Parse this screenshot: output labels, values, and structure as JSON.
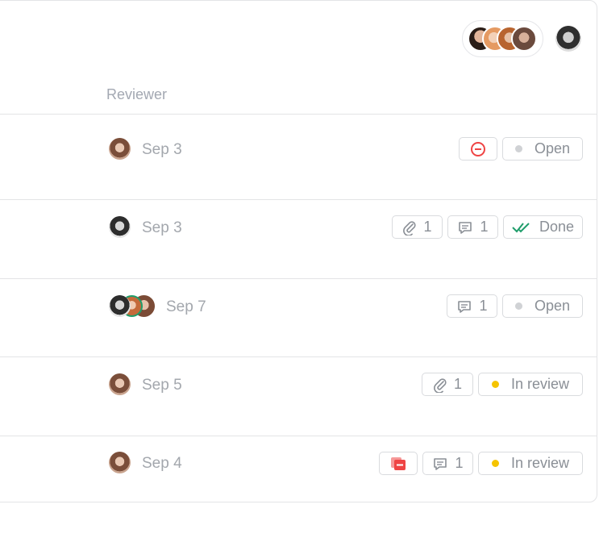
{
  "header": {
    "members_group_avatars": [
      "member-avatar-1",
      "member-avatar-2",
      "member-avatar-3",
      "member-avatar-4"
    ],
    "current_user_avatar": "user-avatar"
  },
  "columns": {
    "reviewer": "Reviewer"
  },
  "rows": [
    {
      "date": "Sep 3",
      "status": "Open"
    },
    {
      "date": "Sep 3",
      "attachments": "1",
      "comments": "1",
      "status": "Done"
    },
    {
      "date": "Sep 7",
      "comments": "1",
      "status": "Open"
    },
    {
      "date": "Sep 5",
      "attachments": "1",
      "status": "In review"
    },
    {
      "date": "Sep 4",
      "comments": "1",
      "status": "In review"
    }
  ],
  "colors": {
    "open": "#d0d2d5",
    "done": "#1f9d6b",
    "in_review": "#f5c400",
    "danger": "#ef4444"
  }
}
